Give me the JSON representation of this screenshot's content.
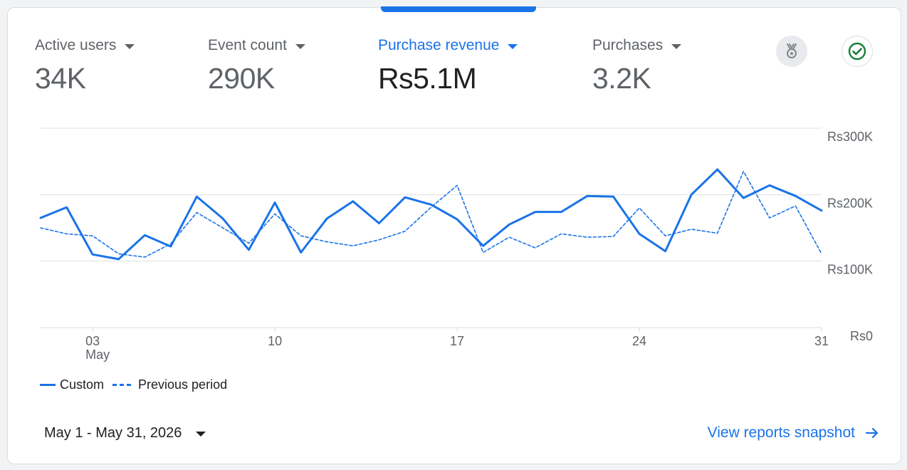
{
  "metrics": [
    {
      "label": "Active users",
      "value": "34K",
      "active": false
    },
    {
      "label": "Event count",
      "value": "290K",
      "active": false
    },
    {
      "label": "Purchase revenue",
      "value": "Rs5.1M",
      "active": true
    },
    {
      "label": "Purchases",
      "value": "3.2K",
      "active": false
    }
  ],
  "icons": {
    "insight": "medal-icon",
    "check": "check-circle-icon"
  },
  "colors": {
    "accent": "#1a73e8",
    "text_primary": "#202124",
    "text_secondary": "#5f6368",
    "grid": "#e0e0e0"
  },
  "chart_data": {
    "type": "line",
    "x": [
      1,
      2,
      3,
      4,
      5,
      6,
      7,
      8,
      9,
      10,
      11,
      12,
      13,
      14,
      15,
      16,
      17,
      18,
      19,
      20,
      21,
      22,
      23,
      24,
      25,
      26,
      27,
      28,
      29,
      30,
      31
    ],
    "x_ticks": [
      {
        "day": 3,
        "label": "03",
        "sublabel": "May"
      },
      {
        "day": 10,
        "label": "10",
        "sublabel": ""
      },
      {
        "day": 17,
        "label": "17",
        "sublabel": ""
      },
      {
        "day": 24,
        "label": "24",
        "sublabel": ""
      },
      {
        "day": 31,
        "label": "31",
        "sublabel": ""
      }
    ],
    "y_ticks": [
      {
        "value": 300000,
        "label": "Rs300K"
      },
      {
        "value": 200000,
        "label": "Rs200K"
      },
      {
        "value": 100000,
        "label": "Rs100K"
      },
      {
        "value": 0,
        "label": "Rs0"
      }
    ],
    "ylim": [
      0,
      300000
    ],
    "grid": true,
    "legend_position": "bottom-left",
    "series": [
      {
        "name": "Custom",
        "style": "solid",
        "values": [
          165000,
          181000,
          110000,
          103000,
          139000,
          122000,
          197000,
          164000,
          117000,
          188000,
          113000,
          164000,
          190000,
          157000,
          196000,
          185000,
          163000,
          123000,
          155000,
          174000,
          174000,
          198000,
          197000,
          141000,
          115000,
          200000,
          238000,
          195000,
          214000,
          198000,
          176000
        ]
      },
      {
        "name": "Previous period",
        "style": "dashed",
        "values": [
          150000,
          141000,
          138000,
          111000,
          106000,
          126000,
          173000,
          150000,
          127000,
          171000,
          138000,
          129000,
          123000,
          132000,
          145000,
          181000,
          214000,
          113000,
          136000,
          120000,
          141000,
          136000,
          137000,
          180000,
          138000,
          148000,
          142000,
          235000,
          165000,
          183000,
          111000
        ]
      }
    ]
  },
  "footer": {
    "date_range": "May 1 - May 31, 2026",
    "snapshot_link": "View reports snapshot"
  }
}
